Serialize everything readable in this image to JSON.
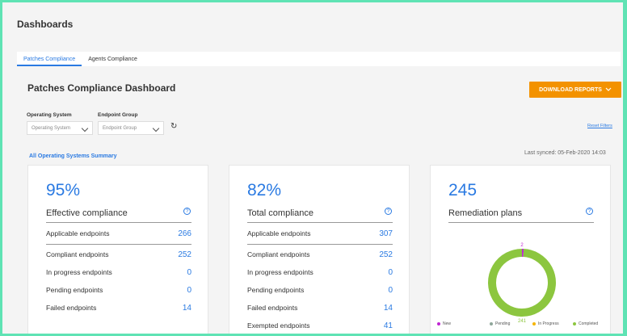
{
  "page": {
    "title": "Dashboards",
    "tabs": [
      {
        "label": "Patches Compliance"
      },
      {
        "label": "Agents Compliance"
      }
    ],
    "dashboard_title": "Patches Compliance Dashboard",
    "download_label": "DOWNLOAD REPORTS",
    "filters": {
      "os_label": "Operating System",
      "os_value": "Operating System",
      "group_label": "Endpoint Group",
      "group_value": "Endpoint Group",
      "reset_label": "Reset Filters"
    },
    "summary_link": "All Operating Systems Summary",
    "last_synced": "Last synced: 05-Feb-2020 14:03"
  },
  "cards": [
    {
      "value": "95%",
      "title": "Effective compliance",
      "rows": [
        {
          "label": "Applicable endpoints",
          "value": "266"
        },
        {
          "label": "Compliant endpoints",
          "value": "252"
        },
        {
          "label": "In progress endpoints",
          "value": "0"
        },
        {
          "label": "Pending endpoints",
          "value": "0"
        },
        {
          "label": "Failed endpoints",
          "value": "14"
        }
      ]
    },
    {
      "value": "82%",
      "title": "Total compliance",
      "rows": [
        {
          "label": "Applicable endpoints",
          "value": "307"
        },
        {
          "label": "Compliant endpoints",
          "value": "252"
        },
        {
          "label": "In progress endpoints",
          "value": "0"
        },
        {
          "label": "Pending endpoints",
          "value": "0"
        },
        {
          "label": "Failed endpoints",
          "value": "14"
        },
        {
          "label": "Exempted endpoints",
          "value": "41"
        }
      ]
    },
    {
      "value": "245",
      "title": "Remediation plans",
      "donut": {
        "top_label": "2",
        "bottom_label": "241",
        "segments": [
          {
            "name": "New",
            "value": 2,
            "color": "#c026d3"
          },
          {
            "name": "Pending",
            "value": 0,
            "color": "#8fa69a"
          },
          {
            "name": "In Progress",
            "value": 0,
            "color": "#f5b400"
          },
          {
            "name": "Completed",
            "value": 241,
            "color": "#8cc63f"
          }
        ]
      }
    }
  ],
  "colors": {
    "accent": "#2a7ae2",
    "button": "#f39200"
  }
}
